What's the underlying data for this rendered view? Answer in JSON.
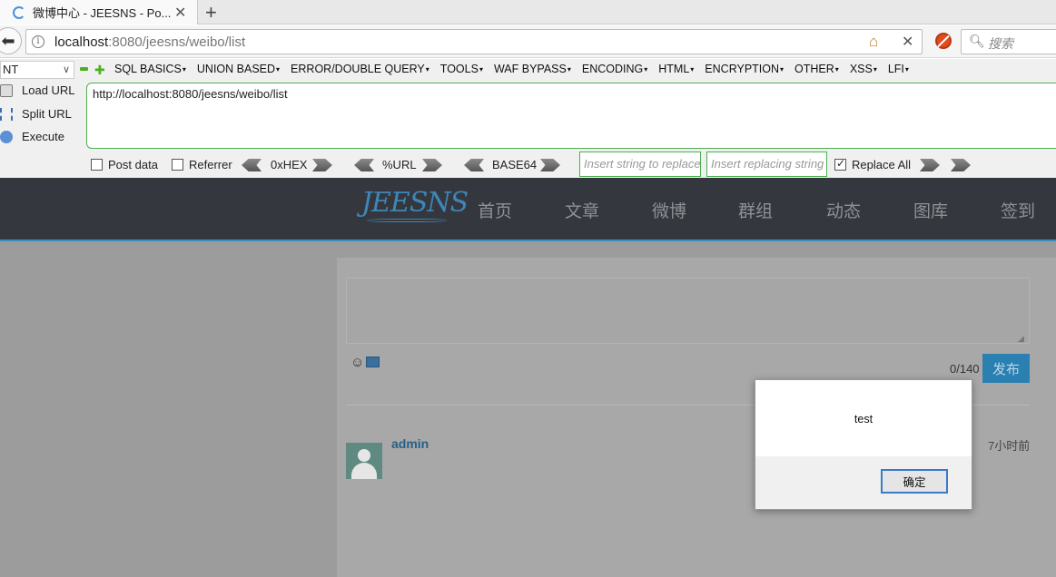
{
  "browser": {
    "tab_title": "微博中心 - JEESNS - Po...",
    "tab_close": "✕",
    "new_tab": "+",
    "url_host": "localhost",
    "url_rest": ":8080/jeesns/weibo/list",
    "search_placeholder": "搜索",
    "icons": [
      "back-arrow-icon",
      "info-icon",
      "home-icon",
      "stop-icon",
      "noscript-icon",
      "search-icon"
    ]
  },
  "hackbar": {
    "select_value": "NT",
    "menu": [
      "SQL BASICS",
      "UNION BASED",
      "ERROR/DOUBLE QUERY",
      "TOOLS",
      "WAF BYPASS",
      "ENCODING",
      "HTML",
      "ENCRYPTION",
      "OTHER",
      "XSS",
      "LFI"
    ],
    "load_url": "Load URL",
    "split_url": "Split URL",
    "execute": "Execute",
    "url_value": "http://localhost:8080/jeesns/weibo/list",
    "post_data": "Post data",
    "referrer": "Referrer",
    "hex": "0xHEX",
    "url_enc": "%URL",
    "base64": "BASE64",
    "replace_placeholder": "Insert string to replace",
    "replacing_placeholder": "Insert replacing string",
    "replace_all": "Replace All",
    "replace_all_checked": true
  },
  "site": {
    "logo": "JEESNS",
    "nav": [
      "首页",
      "文章",
      "微博",
      "群组",
      "动态",
      "图库",
      "签到"
    ],
    "counter": "0/140",
    "publish": "发布",
    "resize_glyph": "◢",
    "emoji_glyph": "☺",
    "post": {
      "username": "admin",
      "time": "7小时前"
    }
  },
  "dialog": {
    "message": "test",
    "ok": "确定"
  }
}
